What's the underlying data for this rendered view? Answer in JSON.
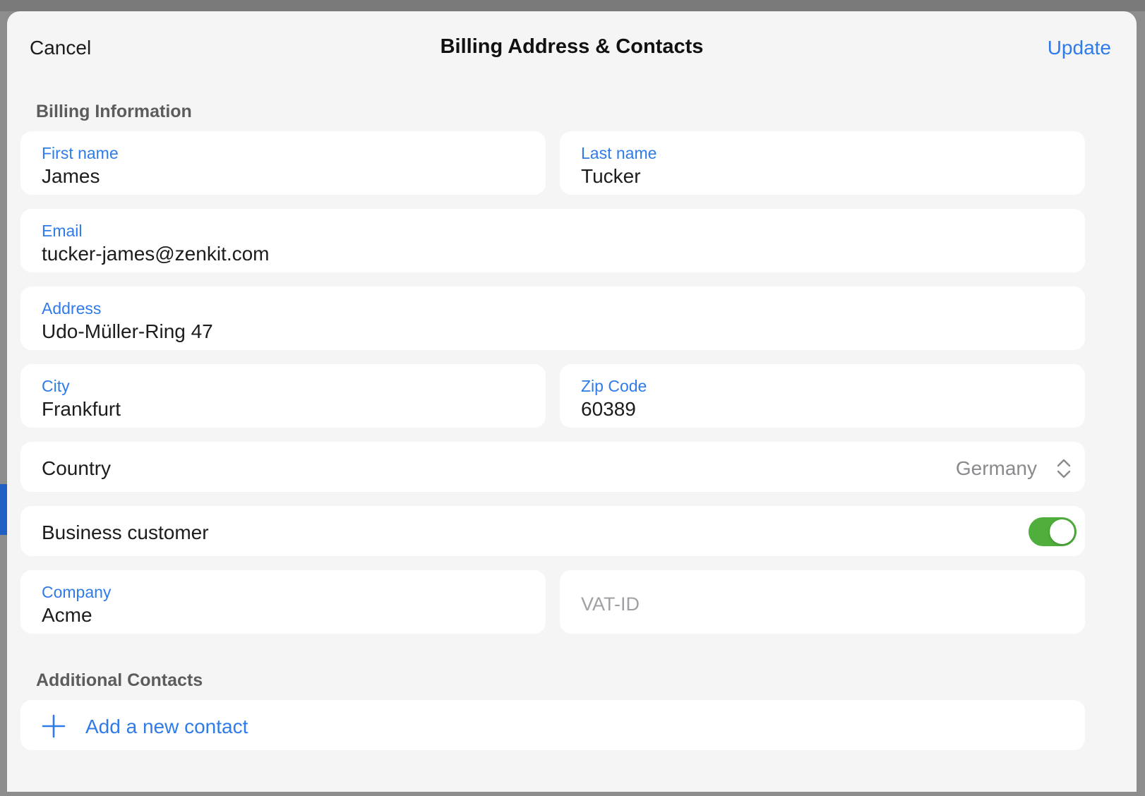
{
  "nav": {
    "cancel_label": "Cancel",
    "title": "Billing Address & Contacts",
    "update_label": "Update"
  },
  "billing": {
    "section_title": "Billing Information",
    "first_name": {
      "label": "First name",
      "value": "James"
    },
    "last_name": {
      "label": "Last name",
      "value": "Tucker"
    },
    "email": {
      "label": "Email",
      "value": "tucker-james@zenkit.com"
    },
    "address": {
      "label": "Address",
      "value": "Udo-Müller-Ring 47"
    },
    "city": {
      "label": "City",
      "value": "Frankfurt"
    },
    "zip": {
      "label": "Zip Code",
      "value": "60389"
    },
    "country": {
      "label": "Country",
      "value": "Germany",
      "icon": "chevron-up-down-icon"
    },
    "business_customer": {
      "label": "Business customer",
      "enabled": true,
      "toggle_color": "#4fae3c"
    },
    "company": {
      "label": "Company",
      "value": "Acme"
    },
    "vat_id": {
      "placeholder": "VAT-ID",
      "value": ""
    }
  },
  "contacts": {
    "section_title": "Additional Contacts",
    "add_label": "Add a new contact",
    "add_icon": "plus-icon"
  },
  "colors": {
    "accent": "#2f7bea",
    "sheet_background": "#f5f5f5",
    "field_background": "#ffffff"
  }
}
